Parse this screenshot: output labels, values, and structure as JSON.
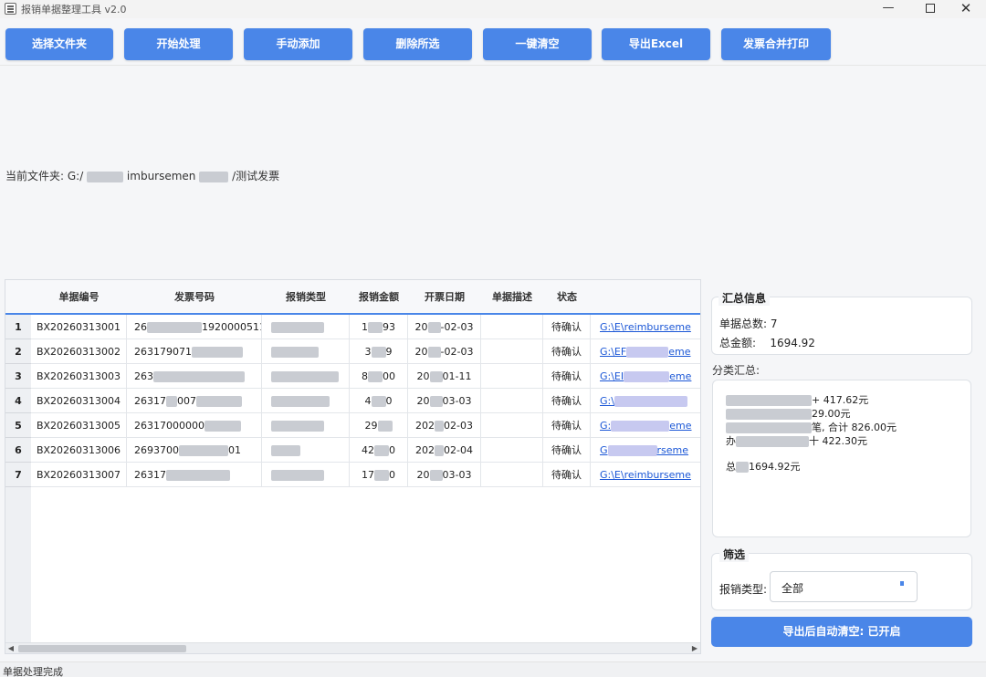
{
  "window": {
    "title": "报销单据整理工具 v2.0",
    "minimize": "—",
    "close": "✕"
  },
  "toolbar": {
    "buttons": [
      "选择文件夹",
      "开始处理",
      "手动添加",
      "删除所选",
      "一键清空",
      "导出Excel",
      "发票合并打印"
    ],
    "color": "#4a86e8"
  },
  "folder": {
    "label": "当前文件夹:",
    "path_start": "G:/",
    "path_mid": "imbursemen",
    "path_end": "/测试发票"
  },
  "table": {
    "headers": [
      "单据编号",
      "发票号码",
      "报销类型",
      "报销金额",
      "开票日期",
      "单据描述",
      "状态"
    ],
    "rows": [
      {
        "num": "1",
        "id": "BX20260313001",
        "invoice": "26",
        "invoice_tail": "1920000511",
        "type": "",
        "amount_a": "1",
        "amount_b": "93",
        "date_a": "20",
        "date_b": "-02-03",
        "desc": "",
        "status": "待确认",
        "path": "G:\\E\\reimburseme"
      },
      {
        "num": "2",
        "id": "BX20260313002",
        "invoice": "263179071",
        "invoice_tail": "",
        "type": "",
        "amount_a": "3",
        "amount_b": "9",
        "date_a": "20",
        "date_b": "-02-03",
        "desc": "",
        "status": "待确认",
        "path": "G:\\EF"
      },
      {
        "num": "3",
        "id": "BX20260313003",
        "invoice": "263",
        "invoice_tail": "",
        "type": "",
        "amount_a": "8",
        "amount_b": "00",
        "date_a": "20",
        "date_b": "01-11",
        "desc": "",
        "status": "待确认",
        "path": "G:\\EI"
      },
      {
        "num": "4",
        "id": "BX20260313004",
        "invoice": "26317",
        "invoice_tail": "007",
        "type": "",
        "amount_a": "4",
        "amount_b": "0",
        "date_a": "20",
        "date_b": "03-03",
        "desc": "",
        "status": "待确认",
        "path": "G:\\"
      },
      {
        "num": "5",
        "id": "BX20260313005",
        "invoice": "26317000000",
        "invoice_tail": "",
        "type": "",
        "amount_a": "29",
        "amount_b": "",
        "date_a": "202",
        "date_b": "02-03",
        "desc": "",
        "status": "待确认",
        "path": "G:"
      },
      {
        "num": "6",
        "id": "BX20260313006",
        "invoice": "2693700",
        "invoice_tail": "01",
        "type": "",
        "amount_a": "42",
        "amount_b": "0",
        "date_a": "202",
        "date_b": "02-04",
        "desc": "",
        "status": "待确认",
        "path": "G"
      },
      {
        "num": "7",
        "id": "BX20260313007",
        "invoice": "26317",
        "invoice_tail": "",
        "type": "",
        "amount_a": "17",
        "amount_b": "0",
        "date_a": "20",
        "date_b": "03-03",
        "desc": "",
        "status": "待确认",
        "path": "G:\\E\\reimburseme"
      }
    ],
    "path_fragments": [
      "eme",
      "eme",
      "eme",
      "rseme"
    ],
    "scroll_left": "◀",
    "scroll_right": "▶"
  },
  "summary": {
    "title": "汇总信息",
    "count_label": "单据总数:",
    "count": "7",
    "total_label": "总金额:",
    "total": "1694.92"
  },
  "category": {
    "label": "分类汇总:",
    "lines": [
      "+ 417.62元",
      "29.00元",
      "笔, 合计 826.00元",
      "十 422.30元",
      "1694.92元"
    ],
    "prefixes": [
      "",
      "",
      "",
      "办",
      "总"
    ]
  },
  "filter": {
    "title": "筛选",
    "type_label": "报销类型:",
    "type_value": "全部"
  },
  "auto_clear_button": "导出后自动清空: 已开启",
  "status_bar": "单据处理完成"
}
